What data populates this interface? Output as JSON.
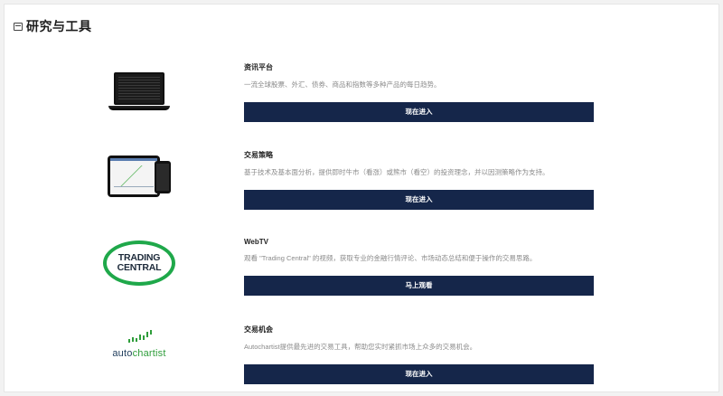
{
  "header": {
    "icon": "inbox-icon",
    "title": "研究与工具"
  },
  "sections": [
    {
      "visual": "laptop-image",
      "name": "资讯平台",
      "desc": "一流全球股票、外汇、债券、商品和指数等多种产品的每日趋势。",
      "button": "现在进入"
    },
    {
      "visual": "tablet-phone-image",
      "name": "交易策略",
      "desc": "基于技术及基本面分析，提供即时牛市（看涨）或熊市（看空）的投资理念，并以因测策略作为支持。",
      "button": "现在进入"
    },
    {
      "visual": "trading-central-logo",
      "logo_text": [
        "TRADING",
        "CENTRAL"
      ],
      "name": "WebTV",
      "desc": "观看 \"Trading Central\" 的视频，获取专业的金融行情评论、市场动态总结和便于操作的交易思路。",
      "button": "马上观看"
    },
    {
      "visual": "autochartist-logo",
      "logo_text": [
        "auto",
        "chartist"
      ],
      "name": "交易机会",
      "desc": "Autochartist提供最先进的交易工具，帮助您实时紧抓市场上众多的交易机会。",
      "button": "现在进入"
    }
  ],
  "colors": {
    "button_bg": "#15264a",
    "brand_green": "#1fa84a"
  }
}
